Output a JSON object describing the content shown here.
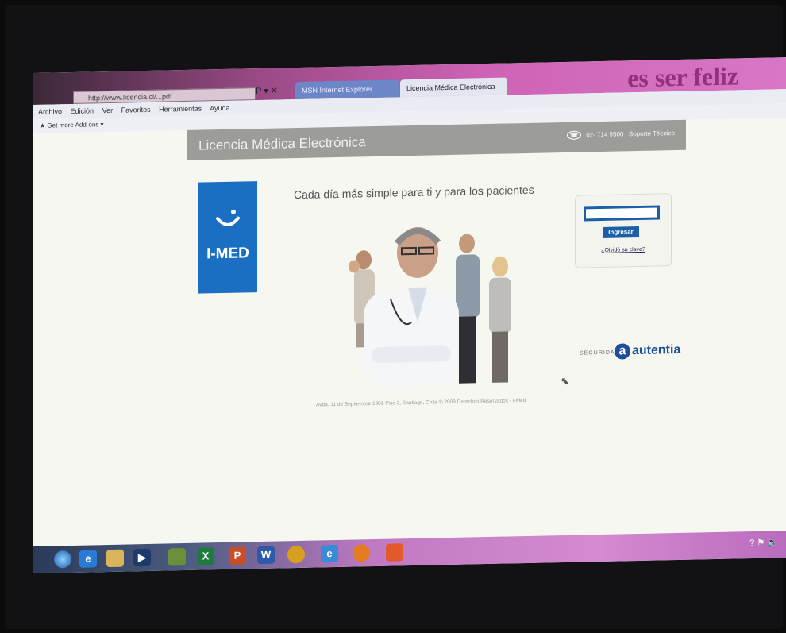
{
  "browser": {
    "address": "http://www.licencia.cl/...pdf",
    "address_controls": "P ▾ ✕",
    "tabs": [
      {
        "label": "MSN Internet Explorer"
      },
      {
        "label": "Licencia Médica Electrónica",
        "close": "×"
      }
    ],
    "menu": [
      "Archivo",
      "Edición",
      "Ver",
      "Favoritos",
      "Herramientas",
      "Ayuda"
    ],
    "favorites_label": "Get more Add-ons ▾",
    "wallpaper_text": "es ser feliz"
  },
  "page": {
    "header_title": "Licencia Médica Electrónica",
    "phone": "02- 714 9500",
    "phone_sep": "|",
    "support": "Soporte Técnico",
    "logo_text": "I-MED",
    "tagline": "Cada día más simple para ti y para los pacientes",
    "login": {
      "input_value": "",
      "button_label": "Ingresar",
      "forgot_label": "¿Olvidó su clave?"
    },
    "security_label": "SEGURIDAD",
    "partner": "autentia",
    "footer": "Avda. 11 de Septiembre 1901 Piso 3, Santiago, Chile © 2009 Derechos Reservados - I-Med"
  },
  "taskbar": {
    "icons": [
      "start-orb",
      "ie",
      "explorer",
      "media",
      "app",
      "excel",
      "powerpoint",
      "word",
      "chrome",
      "ie2",
      "firefox",
      "app2"
    ],
    "help": "?"
  },
  "colors": {
    "brand_blue": "#1b6fc2",
    "header_gray": "#9c9c98",
    "login_blue": "#1b5fa8"
  }
}
